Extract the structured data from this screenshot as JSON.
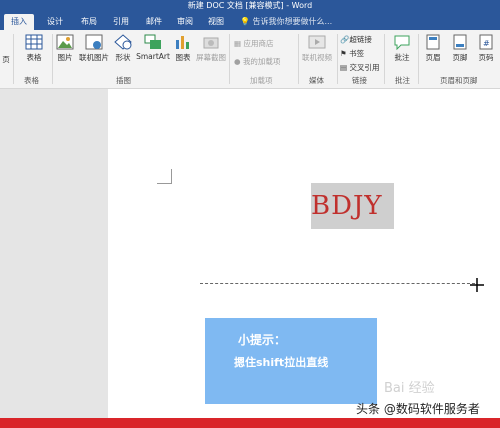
{
  "window": {
    "title": "新建 DOC 文档 [兼容模式] - Word"
  },
  "tabs": [
    {
      "label": "插入",
      "active": true
    },
    {
      "label": "设计"
    },
    {
      "label": "布局"
    },
    {
      "label": "引用"
    },
    {
      "label": "邮件"
    },
    {
      "label": "审阅"
    },
    {
      "label": "视图"
    }
  ],
  "tell_me": "告诉我你想要做什么...",
  "ribbon": {
    "page_partial": "页",
    "table": "表格",
    "picture": "图片",
    "online_picture": "联机图片",
    "shapes": "形状",
    "smartart": "SmartArt",
    "chart": "图表",
    "screenshot": "屏幕截图",
    "app_store": "应用商店",
    "my_addins": "我的加载项",
    "online_video": "联机视频",
    "hyperlink": "超链接",
    "bookmark": "书签",
    "cross_ref": "交叉引用",
    "comment": "批注",
    "header": "页眉",
    "footer": "页脚",
    "page_number": "页码",
    "groups": {
      "tables": "表格",
      "illustrations": "插图",
      "addins": "加载项",
      "media": "媒体",
      "links": "链接",
      "comments": "批注",
      "header_footer": "页眉和页脚"
    }
  },
  "document": {
    "text": "BDJY",
    "tip_title": "小提示：",
    "tip_text": "摁住shift拉出直线"
  },
  "overlay": {
    "watermark": "Bai 经验",
    "credit": "头条 @数码软件服务者"
  }
}
